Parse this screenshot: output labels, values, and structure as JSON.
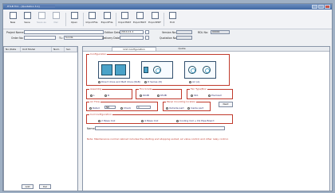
{
  "window": {
    "title": "HYLB TCC - [Quotation 3.1]"
  },
  "toolbar": {
    "buttons": [
      {
        "label": "New",
        "icon": "new-document-icon",
        "enabled": true
      },
      {
        "label": "Save",
        "icon": "save-icon",
        "enabled": true
      },
      {
        "label": "Save as",
        "icon": "save-as-icon",
        "enabled": false
      },
      {
        "label": "Del",
        "icon": "delete-icon",
        "enabled": false
      },
      {
        "label": "Open",
        "icon": "open-folder-icon",
        "enabled": true
      },
      {
        "label": "ImportFile",
        "icon": "import-file-icon",
        "enabled": true
      },
      {
        "label": "ExportFile",
        "icon": "export-file-icon",
        "enabled": true
      },
      {
        "label": "ImportMAT",
        "icon": "import-mat-icon",
        "enabled": true
      },
      {
        "label": "ExportMAT",
        "icon": "export-mat-icon",
        "enabled": true
      },
      {
        "label": "ExportPDF",
        "icon": "export-pdf-icon",
        "enabled": true
      },
      {
        "label": "Exit",
        "icon": "exit-icon",
        "enabled": true
      }
    ]
  },
  "header": {
    "project_name_label": "Project Name:",
    "project_name_value": "",
    "order_no_label": "Order No:",
    "order_no_value": "",
    "tl_label": "TL:",
    "tl_value": "Sunda",
    "edition_date_label": "Edition Date:",
    "edition_date_value": "2014-11-1",
    "delivery_date_label": "Delivery Date:",
    "delivery_date_value": "",
    "version_label": "Version No:",
    "version_value": "",
    "quotation_label": "Quotation No:",
    "quotation_value": "",
    "rdl_label": "RDL No:",
    "rdl_value": "00001"
  },
  "unit_list": {
    "columns": [
      "No./Date",
      "Unit Model",
      "Num.",
      "Sel."
    ],
    "add_label": "Add",
    "del_label": "Del"
  },
  "tabs": [
    {
      "label": "Unit Configuration",
      "active": true
    },
    {
      "label": "Quote",
      "active": false
    }
  ],
  "config": {
    "unit_type_title": "Configuration",
    "unit_types": [
      {
        "label": "Direct drive and Belt drive (DLB)",
        "selected": true
      },
      {
        "label": "D Series (D)",
        "selected": false
      },
      {
        "label": "Air (A)",
        "selected": false
      }
    ],
    "assembly_title": "Assembly",
    "assembly_options": [
      {
        "label": "L",
        "selected": true
      },
      {
        "label": "R",
        "selected": false
      }
    ],
    "fire_grade_title": "Fire Grade",
    "fire_grade_options": [
      {
        "label": "60dB",
        "selected": true
      },
      {
        "label": "65dB",
        "selected": false
      }
    ],
    "fan_type_title": "Fan Type/Box",
    "fan_type_options": [
      {
        "label": "Std.",
        "selected": false
      },
      {
        "label": "Premium",
        "selected": true
      }
    ],
    "next_label": "Next",
    "airflow_title": "Air Flow",
    "airflow_options": [
      {
        "label": "Rated",
        "selected": true
      },
      {
        "label": "Check",
        "selected": false
      }
    ],
    "airflow_value": "NR",
    "fan_speed_value": "1",
    "panel_title": "Panel mounting location",
    "panel_options": [
      {
        "label": "Outside part",
        "selected": true
      },
      {
        "label": "Inside part",
        "selected": false
      }
    ],
    "coil_title": "Coil Configuration",
    "coil_options": [
      {
        "label": "2 Pipes Coil",
        "selected": true
      },
      {
        "label": "4 Pipes Coil",
        "selected": false
      },
      {
        "label": "Cooling Coil + Dx Pipe Board",
        "selected": false
      }
    ],
    "name_label": "Name:",
    "name_value": "",
    "note": "Note: Maintenance normal cabinet includes the starting and stopping socket, air valve control and other relay control."
  }
}
